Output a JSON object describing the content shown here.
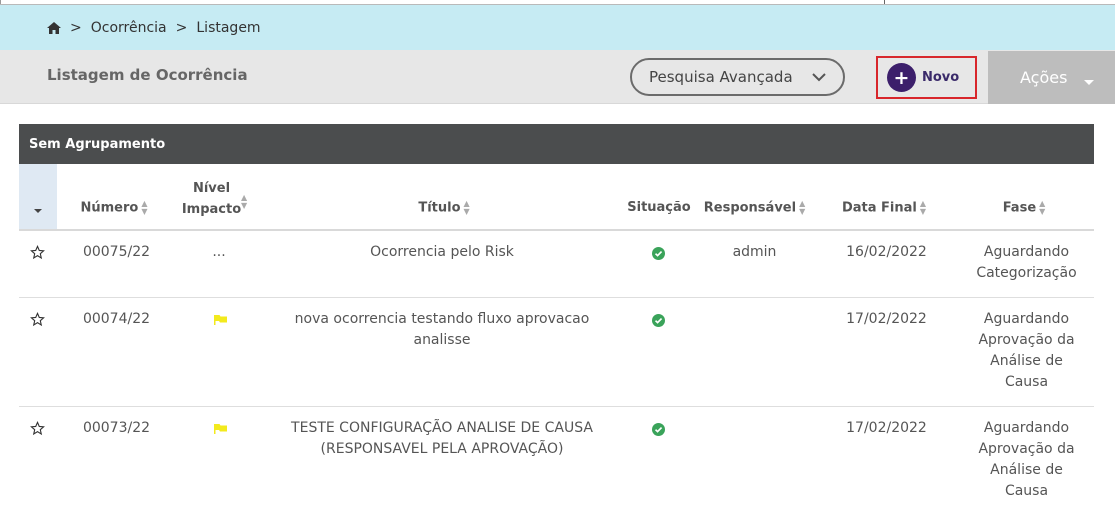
{
  "breadcrumb": {
    "items": [
      "Ocorrência",
      "Listagem"
    ],
    "separator": ">"
  },
  "header": {
    "title": "Listagem de Ocorrência",
    "advanced_search_label": "Pesquisa Avançada",
    "new_label": "Novo",
    "actions_label": "Ações"
  },
  "group": {
    "label": "Sem Agrupamento"
  },
  "columns": {
    "numero": "Número",
    "nivel_line1": "Nível",
    "nivel_line2": "Impacto",
    "titulo": "Título",
    "situacao": "Situação",
    "responsavel": "Responsável",
    "data_final": "Data Final",
    "fase": "Fase"
  },
  "rows": [
    {
      "numero": "00075/22",
      "nivel": "...",
      "titulo": "Ocorrencia pelo Risk",
      "responsavel": "admin",
      "data_final": "16/02/2022",
      "fase_lines": [
        "Aguardando",
        "Categorização"
      ]
    },
    {
      "numero": "00074/22",
      "nivel": "flag",
      "titulo": "nova ocorrencia testando fluxo aprovacao analisse",
      "responsavel": "",
      "data_final": "17/02/2022",
      "fase_lines": [
        "Aguardando",
        "Aprovação da",
        "Análise de",
        "Causa"
      ]
    },
    {
      "numero": "00073/22",
      "nivel": "flag",
      "titulo_lines": [
        "TESTE CONFIGURAÇÃO ANALISE DE CAUSA",
        "(RESPONSAVEL PELA APROVAÇÃO)"
      ],
      "responsavel": "",
      "data_final": "17/02/2022",
      "fase_lines": [
        "Aguardando",
        "Aprovação da",
        "Análise de",
        "Causa"
      ]
    }
  ],
  "colors": {
    "breadcrumb_bg": "#c6ebf3",
    "group_bar": "#4b4d4e",
    "new_button_border": "#d8262b",
    "new_icon": "#3c1f6b",
    "status_ok": "#3aa35a",
    "flag": "#f3ea1d"
  },
  "icons": {
    "home": "home-icon",
    "chevron": "chevron-down-icon",
    "plus": "plus-icon",
    "star": "star-outline-icon",
    "check": "check-circle-icon",
    "flag": "flag-icon"
  }
}
